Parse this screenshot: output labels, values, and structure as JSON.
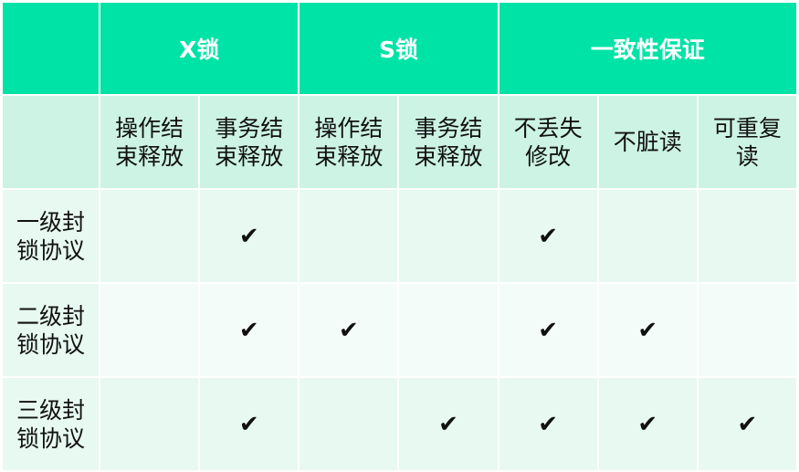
{
  "header_groups": [
    {
      "label": "X锁"
    },
    {
      "label": "S锁"
    },
    {
      "label": "一致性保证"
    }
  ],
  "sub_headers": [
    "操作结束释放",
    "事务结束释放",
    "操作结束释放",
    "事务结束释放",
    "不丢失修改",
    "不脏读",
    "可重复读"
  ],
  "rows": [
    {
      "label": "一级封锁协议",
      "cells": [
        "",
        "✔",
        "",
        "",
        "✔",
        "",
        ""
      ]
    },
    {
      "label": "二级封锁协议",
      "cells": [
        "",
        "✔",
        "✔",
        "",
        "✔",
        "✔",
        ""
      ]
    },
    {
      "label": "三级封锁协议",
      "cells": [
        "",
        "✔",
        "",
        "✔",
        "✔",
        "✔",
        "✔"
      ]
    }
  ],
  "colors": {
    "header_bg": "#00e3a6",
    "subheader_bg": "#ccf3e4",
    "row_bg_a": "#e7f9f1",
    "row_bg_b": "#f3fcf8"
  }
}
